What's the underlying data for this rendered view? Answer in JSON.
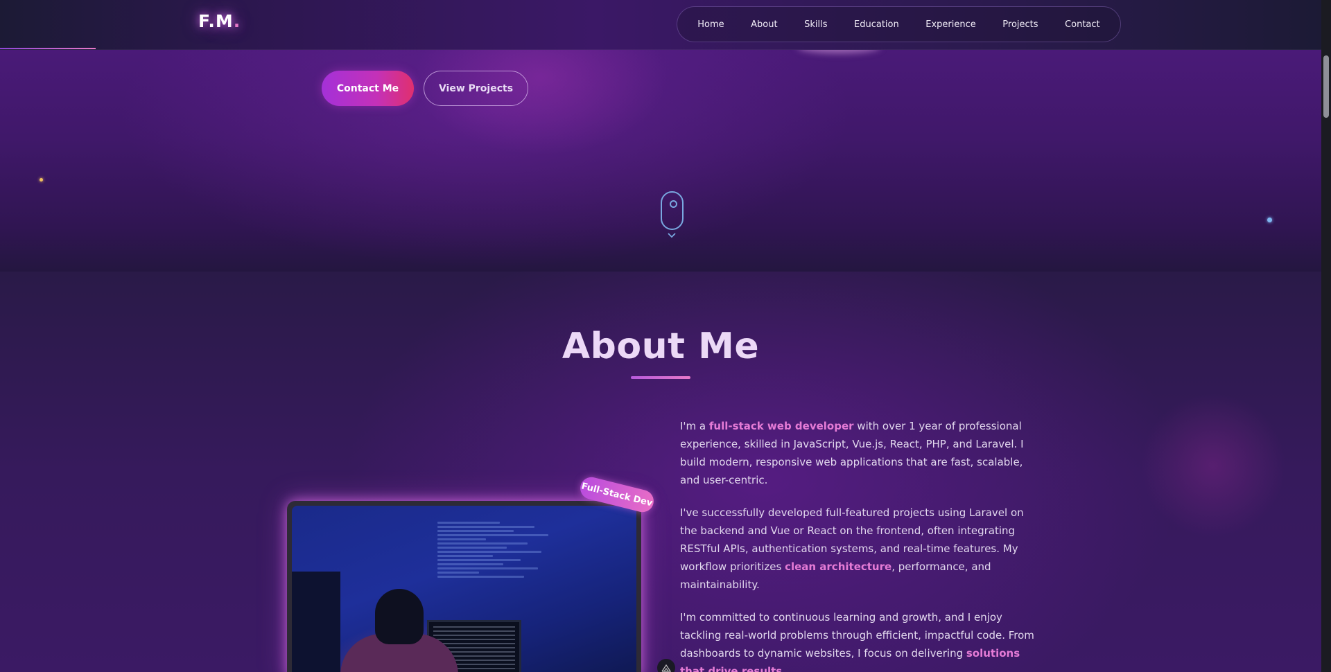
{
  "header": {
    "logo_text": "F.M",
    "logo_dot": ".",
    "nav": {
      "home": "Home",
      "about": "About",
      "skills": "Skills",
      "education": "Education",
      "experience": "Experience",
      "projects": "Projects",
      "contact": "Contact"
    }
  },
  "hero": {
    "contact_button": "Contact Me",
    "projects_button": "View Projects",
    "scroll_indicator_icon": "chevron-down-icon"
  },
  "about": {
    "title": "About Me",
    "badge": "Full-Stack Dev",
    "image_alt": "Developer working at a computer with code on screens",
    "p1": {
      "before": "I'm a ",
      "highlight": "full-stack web developer",
      "after": " with over 1 year of professional experience, skilled in JavaScript, Vue.js, React, PHP, and Laravel. I build modern, responsive web applications that are fast, scalable, and user-centric."
    },
    "p2": {
      "before": "I've successfully developed full-featured projects using Laravel on the backend and Vue or React on the frontend, often integrating RESTful APIs, authentication systems, and real-time features. My workflow prioritizes ",
      "highlight": "clean architecture",
      "after": ", performance, and maintainability."
    },
    "p3": {
      "before": "I'm committed to continuous learning and growth, and I enjoy tackling real-world problems through efficient, impactful code. From dashboards to dynamic websites, I focus on delivering ",
      "highlight": "solutions that drive results",
      "after": "."
    }
  },
  "colors": {
    "accent_pink": "#e879c9",
    "accent_purple": "#a431d8",
    "highlight_text": "#e57bd6",
    "scroll_indicator": "#79a8e0"
  }
}
